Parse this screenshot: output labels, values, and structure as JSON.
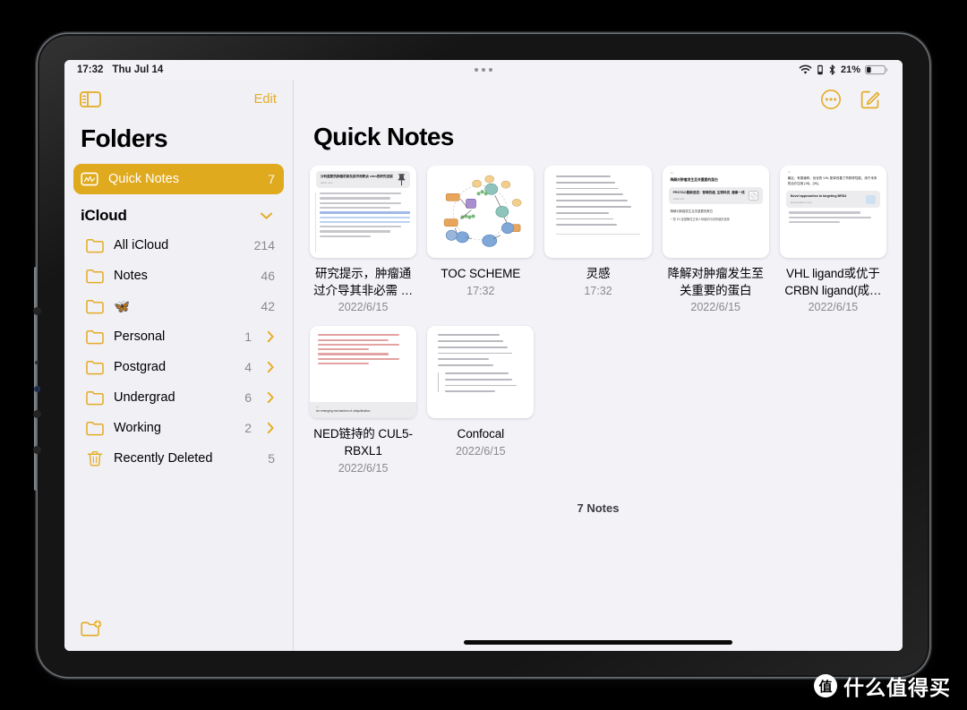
{
  "status_bar": {
    "time": "17:32",
    "date": "Thu Jul 14",
    "battery_percent": "21%",
    "icons": [
      "wifi-icon",
      "orientation-lock-icon",
      "bluetooth-icon",
      "battery-icon"
    ]
  },
  "sidebar": {
    "toggle_icon": "sidebar-toggle-icon",
    "edit_label": "Edit",
    "title": "Folders",
    "quick_notes": {
      "label": "Quick Notes",
      "count": "7",
      "icon": "quick-note-icon"
    },
    "section": {
      "label": "iCloud",
      "chevron": "chevron-down-icon"
    },
    "folders": [
      {
        "label": "All iCloud",
        "count": "214",
        "chevron": false
      },
      {
        "label": "Notes",
        "count": "46",
        "chevron": false
      },
      {
        "label": "🦋",
        "count": "42",
        "chevron": false
      },
      {
        "label": "Personal",
        "count": "1",
        "chevron": true
      },
      {
        "label": "Postgrad",
        "count": "4",
        "chevron": true
      },
      {
        "label": "Undergrad",
        "count": "6",
        "chevron": true
      },
      {
        "label": "Working",
        "count": "2",
        "chevron": true
      },
      {
        "label": "Recently Deleted",
        "count": "5",
        "chevron": false,
        "icon": "trash-icon"
      }
    ],
    "footer_icon": "new-folder-icon"
  },
  "content": {
    "title": "Quick Notes",
    "toolbar": [
      "more-options-icon",
      "compose-note-icon"
    ],
    "note_count_label": "7 Notes",
    "notes": [
      {
        "title": "研究提示，肿瘤通过介导其非必需 …",
        "date": "2022/6/15",
        "pinned": true,
        "thumb": "document"
      },
      {
        "title": "TOC SCHEME",
        "date": "17:32",
        "pinned": false,
        "thumb": "diagram"
      },
      {
        "title": "灵感",
        "date": "17:32",
        "pinned": false,
        "thumb": "handwriting"
      },
      {
        "title": "降解对肿瘤发生至关重要的蛋白",
        "date": "2022/6/15",
        "pinned": false,
        "thumb": "linkcard"
      },
      {
        "title": "VHL ligand或优于 CRBN ligand(成…",
        "date": "2022/6/15",
        "pinned": false,
        "thumb": "quote"
      },
      {
        "title": "NED链持的 CUL5-RBXL1",
        "date": "2022/6/15",
        "pinned": false,
        "thumb": "redink"
      },
      {
        "title": "Confocal",
        "date": "2022/6/15",
        "pinned": false,
        "thumb": "notes"
      }
    ]
  },
  "thumbnails": {
    "doc_link_title": "沙利度胺抗肿瘤机制及其作用靶点 crbn的研究进展",
    "doc_link_url": "docin.com",
    "linkcard_quote": "降解对肿瘤发生至关重要的蛋白",
    "linkcard_title": "PROTAC最新进述：智嘀抗癌_生物科技_健康一线",
    "linkcard_url": "xxdk.com",
    "linkcard_body1": "降解对肿瘤发生至关重要的蛋白",
    "linkcard_body2": "一些 E3 连接酶在正常人体组织中具有组织选择",
    "quote_text": "最近，有报道称，优化的 VHL 配体改善了药物样性能，用于未来的治疗应用 [18]、[26]。",
    "quote_link_title": "Novel approaches to targeting BRD4",
    "quote_link_url": "sciencedirect.com",
    "redink_link": "An emerging mechanism of ubiquitination"
  },
  "watermark": {
    "logo_char": "值",
    "text": "什么值得买"
  },
  "colors": {
    "accent": "#e0aa1e",
    "accent_light": "#e5ac24",
    "sidebar_bg": "#f0f0f5",
    "content_bg": "#f2f2f7",
    "secondary_text": "#8a8a8e"
  }
}
